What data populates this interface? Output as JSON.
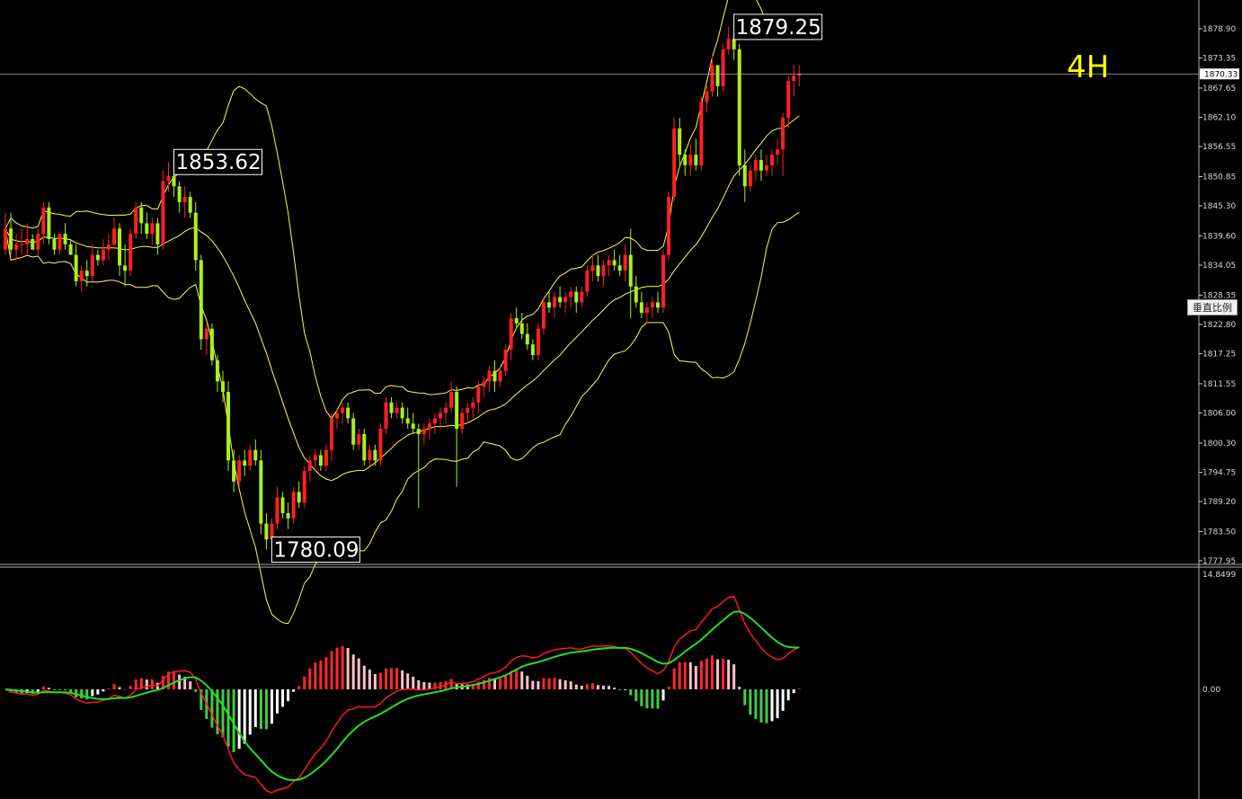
{
  "timeframe_label": "4H",
  "scale_button_label": "垂直比例",
  "colors": {
    "background": "#000000",
    "bull_candle": "#ff2020",
    "bear_candle": "#a8f020",
    "bollinger": "#ffff40",
    "macd_line": "#ff1a1a",
    "signal_line": "#22e022",
    "hist_pos_strong": "#ff2a2a",
    "hist_pos_weak": "#ffc0c8",
    "hist_neg_strong": "#44cc44",
    "hist_neg_weak": "#ffffff",
    "grid_line": "#b0b0b0"
  },
  "callouts": [
    {
      "text": "1853.62",
      "value": 1853.62
    },
    {
      "text": "1879.25",
      "value": 1879.25
    },
    {
      "text": "1780.09",
      "value": 1780.09
    }
  ],
  "chart_data": [
    {
      "type": "candlestick",
      "title": "",
      "price_axis_ticks": [
        "1878.90",
        "1873.35",
        "1867.65",
        "1862.10",
        "1856.55",
        "1850.85",
        "1845.30",
        "1839.60",
        "1834.05",
        "1828.35",
        "1822.80",
        "1817.25",
        "1811.55",
        "1806.00",
        "1800.30",
        "1794.75",
        "1789.20",
        "1783.50",
        "1777.95"
      ],
      "current_price": "1870.33",
      "ylim": [
        1777.95,
        1878.9
      ],
      "overlays": [
        "Bollinger Bands (upper, middle, lower)"
      ],
      "candles": [
        {
          "o": 1837,
          "h": 1844,
          "l": 1836,
          "c": 1841
        },
        {
          "o": 1841,
          "h": 1844,
          "l": 1836,
          "c": 1837
        },
        {
          "o": 1837,
          "h": 1840,
          "l": 1835,
          "c": 1838
        },
        {
          "o": 1838,
          "h": 1841,
          "l": 1836,
          "c": 1838
        },
        {
          "o": 1838,
          "h": 1842,
          "l": 1836,
          "c": 1839
        },
        {
          "o": 1839,
          "h": 1840,
          "l": 1837,
          "c": 1837
        },
        {
          "o": 1837,
          "h": 1841,
          "l": 1836,
          "c": 1840
        },
        {
          "o": 1840,
          "h": 1846,
          "l": 1838,
          "c": 1845
        },
        {
          "o": 1845,
          "h": 1846,
          "l": 1838,
          "c": 1839
        },
        {
          "o": 1839,
          "h": 1840,
          "l": 1836,
          "c": 1837
        },
        {
          "o": 1837,
          "h": 1840,
          "l": 1836,
          "c": 1840
        },
        {
          "o": 1840,
          "h": 1842,
          "l": 1837,
          "c": 1838
        },
        {
          "o": 1838,
          "h": 1839,
          "l": 1836,
          "c": 1836
        },
        {
          "o": 1836,
          "h": 1838,
          "l": 1830,
          "c": 1831
        },
        {
          "o": 1831,
          "h": 1834,
          "l": 1829,
          "c": 1833
        },
        {
          "o": 1833,
          "h": 1835,
          "l": 1830,
          "c": 1832
        },
        {
          "o": 1832,
          "h": 1838,
          "l": 1831,
          "c": 1836
        },
        {
          "o": 1836,
          "h": 1837,
          "l": 1834,
          "c": 1835
        },
        {
          "o": 1835,
          "h": 1839,
          "l": 1834,
          "c": 1837
        },
        {
          "o": 1837,
          "h": 1840,
          "l": 1835,
          "c": 1838
        },
        {
          "o": 1838,
          "h": 1843,
          "l": 1837,
          "c": 1841
        },
        {
          "o": 1841,
          "h": 1842,
          "l": 1832,
          "c": 1834
        },
        {
          "o": 1834,
          "h": 1838,
          "l": 1830,
          "c": 1833
        },
        {
          "o": 1833,
          "h": 1841,
          "l": 1832,
          "c": 1840
        },
        {
          "o": 1840,
          "h": 1846,
          "l": 1839,
          "c": 1845
        },
        {
          "o": 1845,
          "h": 1846,
          "l": 1840,
          "c": 1842
        },
        {
          "o": 1842,
          "h": 1844,
          "l": 1839,
          "c": 1840
        },
        {
          "o": 1840,
          "h": 1843,
          "l": 1838,
          "c": 1842
        },
        {
          "o": 1842,
          "h": 1843,
          "l": 1836,
          "c": 1838
        },
        {
          "o": 1838,
          "h": 1852,
          "l": 1837,
          "c": 1850
        },
        {
          "o": 1850,
          "h": 1853.62,
          "l": 1848,
          "c": 1851
        },
        {
          "o": 1851,
          "h": 1853,
          "l": 1847,
          "c": 1849
        },
        {
          "o": 1849,
          "h": 1850,
          "l": 1844,
          "c": 1846
        },
        {
          "o": 1846,
          "h": 1849,
          "l": 1843,
          "c": 1847
        },
        {
          "o": 1847,
          "h": 1848,
          "l": 1843,
          "c": 1844
        },
        {
          "o": 1844,
          "h": 1846,
          "l": 1833,
          "c": 1835
        },
        {
          "o": 1835,
          "h": 1836,
          "l": 1818,
          "c": 1820
        },
        {
          "o": 1820,
          "h": 1823,
          "l": 1817,
          "c": 1822
        },
        {
          "o": 1822,
          "h": 1823,
          "l": 1815,
          "c": 1816
        },
        {
          "o": 1816,
          "h": 1817,
          "l": 1810,
          "c": 1812
        },
        {
          "o": 1812,
          "h": 1814,
          "l": 1808,
          "c": 1810
        },
        {
          "o": 1810,
          "h": 1812,
          "l": 1795,
          "c": 1797
        },
        {
          "o": 1797,
          "h": 1799,
          "l": 1791,
          "c": 1793
        },
        {
          "o": 1793,
          "h": 1798,
          "l": 1792,
          "c": 1797
        },
        {
          "o": 1797,
          "h": 1799,
          "l": 1794,
          "c": 1796
        },
        {
          "o": 1796,
          "h": 1800,
          "l": 1795,
          "c": 1799
        },
        {
          "o": 1799,
          "h": 1801,
          "l": 1796,
          "c": 1797
        },
        {
          "o": 1797,
          "h": 1799,
          "l": 1783,
          "c": 1785
        },
        {
          "o": 1785,
          "h": 1787,
          "l": 1780.09,
          "c": 1782
        },
        {
          "o": 1782,
          "h": 1786,
          "l": 1781,
          "c": 1785
        },
        {
          "o": 1785,
          "h": 1792,
          "l": 1784,
          "c": 1790
        },
        {
          "o": 1790,
          "h": 1791,
          "l": 1786,
          "c": 1787
        },
        {
          "o": 1787,
          "h": 1789,
          "l": 1784,
          "c": 1786
        },
        {
          "o": 1786,
          "h": 1792,
          "l": 1785,
          "c": 1791
        },
        {
          "o": 1791,
          "h": 1793,
          "l": 1788,
          "c": 1789
        },
        {
          "o": 1789,
          "h": 1796,
          "l": 1788,
          "c": 1795
        },
        {
          "o": 1795,
          "h": 1798,
          "l": 1793,
          "c": 1797
        },
        {
          "o": 1797,
          "h": 1799,
          "l": 1795,
          "c": 1798
        },
        {
          "o": 1798,
          "h": 1799,
          "l": 1795,
          "c": 1796
        },
        {
          "o": 1796,
          "h": 1800,
          "l": 1795,
          "c": 1799
        },
        {
          "o": 1799,
          "h": 1806,
          "l": 1797,
          "c": 1805
        },
        {
          "o": 1805,
          "h": 1807,
          "l": 1803,
          "c": 1806
        },
        {
          "o": 1806,
          "h": 1808,
          "l": 1804,
          "c": 1807
        },
        {
          "o": 1807,
          "h": 1808,
          "l": 1804,
          "c": 1805
        },
        {
          "o": 1805,
          "h": 1806,
          "l": 1799,
          "c": 1800
        },
        {
          "o": 1800,
          "h": 1803,
          "l": 1799,
          "c": 1802
        },
        {
          "o": 1802,
          "h": 1803,
          "l": 1796,
          "c": 1797
        },
        {
          "o": 1797,
          "h": 1800,
          "l": 1796,
          "c": 1799
        },
        {
          "o": 1799,
          "h": 1800,
          "l": 1796,
          "c": 1797
        },
        {
          "o": 1797,
          "h": 1804,
          "l": 1796,
          "c": 1803
        },
        {
          "o": 1803,
          "h": 1809,
          "l": 1802,
          "c": 1808
        },
        {
          "o": 1808,
          "h": 1809,
          "l": 1805,
          "c": 1806
        },
        {
          "o": 1806,
          "h": 1808,
          "l": 1805,
          "c": 1807
        },
        {
          "o": 1807,
          "h": 1808,
          "l": 1804,
          "c": 1805
        },
        {
          "o": 1805,
          "h": 1807,
          "l": 1803,
          "c": 1804
        },
        {
          "o": 1804,
          "h": 1806,
          "l": 1802,
          "c": 1803
        },
        {
          "o": 1803,
          "h": 1804,
          "l": 1788,
          "c": 1802
        },
        {
          "o": 1802,
          "h": 1804,
          "l": 1800,
          "c": 1803
        },
        {
          "o": 1803,
          "h": 1805,
          "l": 1801,
          "c": 1804
        },
        {
          "o": 1804,
          "h": 1806,
          "l": 1802,
          "c": 1805
        },
        {
          "o": 1805,
          "h": 1807,
          "l": 1803,
          "c": 1806
        },
        {
          "o": 1806,
          "h": 1808,
          "l": 1804,
          "c": 1807
        },
        {
          "o": 1807,
          "h": 1812,
          "l": 1806,
          "c": 1810
        },
        {
          "o": 1810,
          "h": 1811,
          "l": 1792,
          "c": 1803
        },
        {
          "o": 1803,
          "h": 1807,
          "l": 1802,
          "c": 1806
        },
        {
          "o": 1806,
          "h": 1808,
          "l": 1804,
          "c": 1807
        },
        {
          "o": 1807,
          "h": 1809,
          "l": 1805,
          "c": 1808
        },
        {
          "o": 1808,
          "h": 1812,
          "l": 1806,
          "c": 1811
        },
        {
          "o": 1811,
          "h": 1813,
          "l": 1809,
          "c": 1812
        },
        {
          "o": 1812,
          "h": 1815,
          "l": 1810,
          "c": 1814
        },
        {
          "o": 1814,
          "h": 1816,
          "l": 1810,
          "c": 1812
        },
        {
          "o": 1812,
          "h": 1815,
          "l": 1811,
          "c": 1814
        },
        {
          "o": 1814,
          "h": 1819,
          "l": 1813,
          "c": 1818
        },
        {
          "o": 1818,
          "h": 1825,
          "l": 1816,
          "c": 1824
        },
        {
          "o": 1824,
          "h": 1826,
          "l": 1822,
          "c": 1823
        },
        {
          "o": 1823,
          "h": 1825,
          "l": 1820,
          "c": 1821
        },
        {
          "o": 1821,
          "h": 1823,
          "l": 1818,
          "c": 1819
        },
        {
          "o": 1819,
          "h": 1820,
          "l": 1816,
          "c": 1817
        },
        {
          "o": 1817,
          "h": 1823,
          "l": 1816,
          "c": 1822
        },
        {
          "o": 1822,
          "h": 1828,
          "l": 1821,
          "c": 1827
        },
        {
          "o": 1827,
          "h": 1829,
          "l": 1825,
          "c": 1826
        },
        {
          "o": 1826,
          "h": 1829,
          "l": 1824,
          "c": 1828
        },
        {
          "o": 1828,
          "h": 1830,
          "l": 1826,
          "c": 1827
        },
        {
          "o": 1827,
          "h": 1829,
          "l": 1825,
          "c": 1828
        },
        {
          "o": 1828,
          "h": 1830,
          "l": 1826,
          "c": 1829
        },
        {
          "o": 1829,
          "h": 1830,
          "l": 1825,
          "c": 1827
        },
        {
          "o": 1827,
          "h": 1830,
          "l": 1826,
          "c": 1829
        },
        {
          "o": 1829,
          "h": 1834,
          "l": 1828,
          "c": 1833
        },
        {
          "o": 1833,
          "h": 1836,
          "l": 1831,
          "c": 1834
        },
        {
          "o": 1834,
          "h": 1836,
          "l": 1831,
          "c": 1832
        },
        {
          "o": 1832,
          "h": 1835,
          "l": 1830,
          "c": 1834
        },
        {
          "o": 1834,
          "h": 1836,
          "l": 1832,
          "c": 1835
        },
        {
          "o": 1835,
          "h": 1837,
          "l": 1833,
          "c": 1834
        },
        {
          "o": 1834,
          "h": 1836,
          "l": 1832,
          "c": 1833
        },
        {
          "o": 1833,
          "h": 1838,
          "l": 1831,
          "c": 1836
        },
        {
          "o": 1836,
          "h": 1841,
          "l": 1824,
          "c": 1830
        },
        {
          "o": 1830,
          "h": 1832,
          "l": 1826,
          "c": 1827
        },
        {
          "o": 1827,
          "h": 1829,
          "l": 1824,
          "c": 1825
        },
        {
          "o": 1825,
          "h": 1827,
          "l": 1823,
          "c": 1826
        },
        {
          "o": 1826,
          "h": 1828,
          "l": 1824,
          "c": 1827
        },
        {
          "o": 1827,
          "h": 1829,
          "l": 1825,
          "c": 1826
        },
        {
          "o": 1826,
          "h": 1837,
          "l": 1825,
          "c": 1836
        },
        {
          "o": 1836,
          "h": 1848,
          "l": 1835,
          "c": 1847
        },
        {
          "o": 1847,
          "h": 1862,
          "l": 1846,
          "c": 1860
        },
        {
          "o": 1860,
          "h": 1862,
          "l": 1853,
          "c": 1855
        },
        {
          "o": 1855,
          "h": 1856,
          "l": 1851,
          "c": 1853
        },
        {
          "o": 1853,
          "h": 1857,
          "l": 1851,
          "c": 1855
        },
        {
          "o": 1855,
          "h": 1858,
          "l": 1852,
          "c": 1853
        },
        {
          "o": 1853,
          "h": 1866,
          "l": 1852,
          "c": 1865
        },
        {
          "o": 1865,
          "h": 1868,
          "l": 1863,
          "c": 1867
        },
        {
          "o": 1867,
          "h": 1874,
          "l": 1866,
          "c": 1872
        },
        {
          "o": 1872,
          "h": 1871,
          "l": 1866,
          "c": 1868
        },
        {
          "o": 1868,
          "h": 1876,
          "l": 1867,
          "c": 1875
        },
        {
          "o": 1875,
          "h": 1879.25,
          "l": 1874,
          "c": 1877
        },
        {
          "o": 1877,
          "h": 1878,
          "l": 1873,
          "c": 1875
        },
        {
          "o": 1875,
          "h": 1876,
          "l": 1851,
          "c": 1853
        },
        {
          "o": 1853,
          "h": 1856,
          "l": 1846,
          "c": 1849
        },
        {
          "o": 1849,
          "h": 1853,
          "l": 1848,
          "c": 1852
        },
        {
          "o": 1852,
          "h": 1855,
          "l": 1850,
          "c": 1854
        },
        {
          "o": 1854,
          "h": 1856,
          "l": 1850,
          "c": 1852
        },
        {
          "o": 1852,
          "h": 1855,
          "l": 1851,
          "c": 1853
        },
        {
          "o": 1853,
          "h": 1856,
          "l": 1851,
          "c": 1855
        },
        {
          "o": 1855,
          "h": 1858,
          "l": 1853,
          "c": 1856
        },
        {
          "o": 1856,
          "h": 1863,
          "l": 1851,
          "c": 1862
        },
        {
          "o": 1862,
          "h": 1870,
          "l": 1860,
          "c": 1869
        },
        {
          "o": 1869,
          "h": 1872,
          "l": 1866,
          "c": 1870
        },
        {
          "o": 1870,
          "h": 1872,
          "l": 1868,
          "c": 1870.33
        }
      ]
    },
    {
      "type": "macd",
      "title": "",
      "axis_ticks": [
        "14.8499",
        "0.00"
      ],
      "ylim": [
        -20,
        14.8499
      ]
    }
  ]
}
